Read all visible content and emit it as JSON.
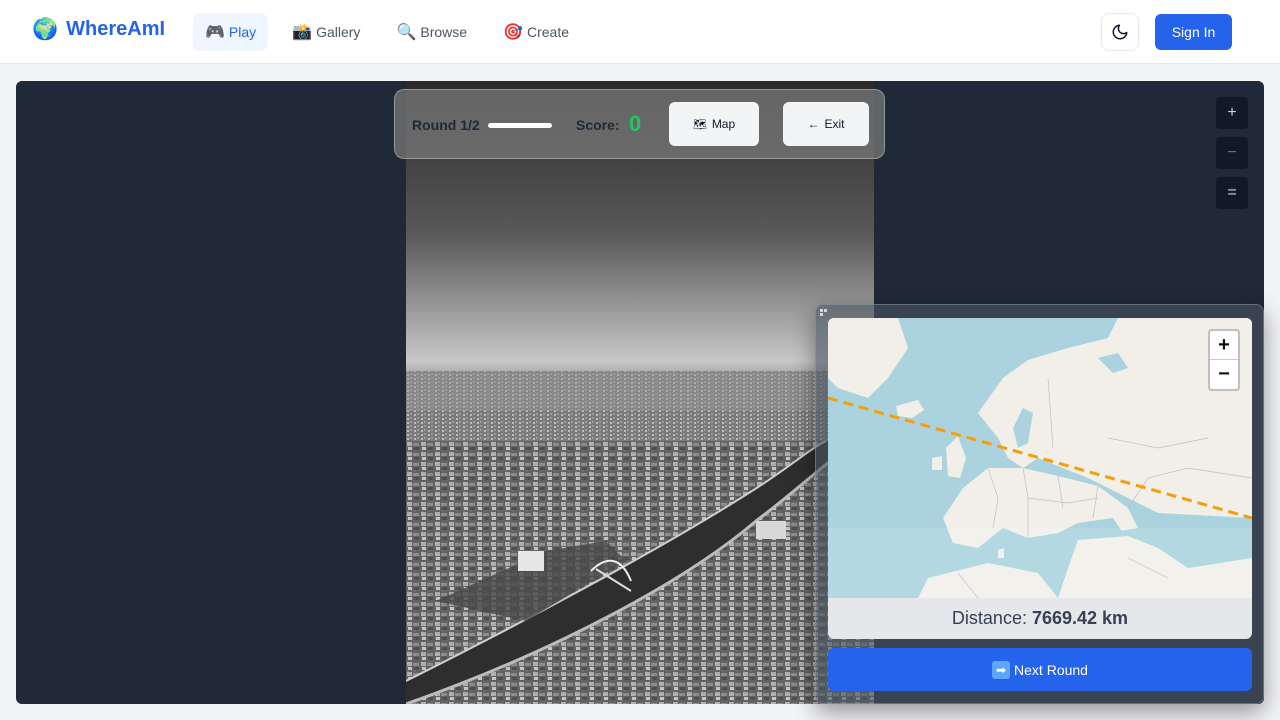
{
  "header": {
    "logo_icon": "🌍",
    "logo_text": "WhereAmI",
    "nav": [
      {
        "icon": "🎮",
        "label": "Play",
        "active": true
      },
      {
        "icon": "📸",
        "label": "Gallery",
        "active": false
      },
      {
        "icon": "🔍",
        "label": "Browse",
        "active": false
      },
      {
        "icon": "🎯",
        "label": "Create",
        "active": false
      }
    ],
    "theme_icon": "moon-icon",
    "sign_in": "Sign In"
  },
  "hud": {
    "round_label": "Round 1/2",
    "round_progress": 1.0,
    "score_label": "Score:",
    "score_value": "0",
    "map_button": "Map",
    "map_icon": "🗺",
    "exit_button": "Exit",
    "exit_icon": "←"
  },
  "photo_controls": {
    "zoom_in": "+",
    "zoom_out": "−",
    "reset": "="
  },
  "map_panel": {
    "zoom_in": "+",
    "zoom_out": "−",
    "distance_label": "Distance:",
    "distance_value": "7669.42 km",
    "next_round": "Next Round",
    "next_icon": "➡"
  },
  "colors": {
    "brand": "#2563eb",
    "score": "#22c55e",
    "guess_line": "#f59e0b",
    "stage_bg": "#1f2937"
  }
}
